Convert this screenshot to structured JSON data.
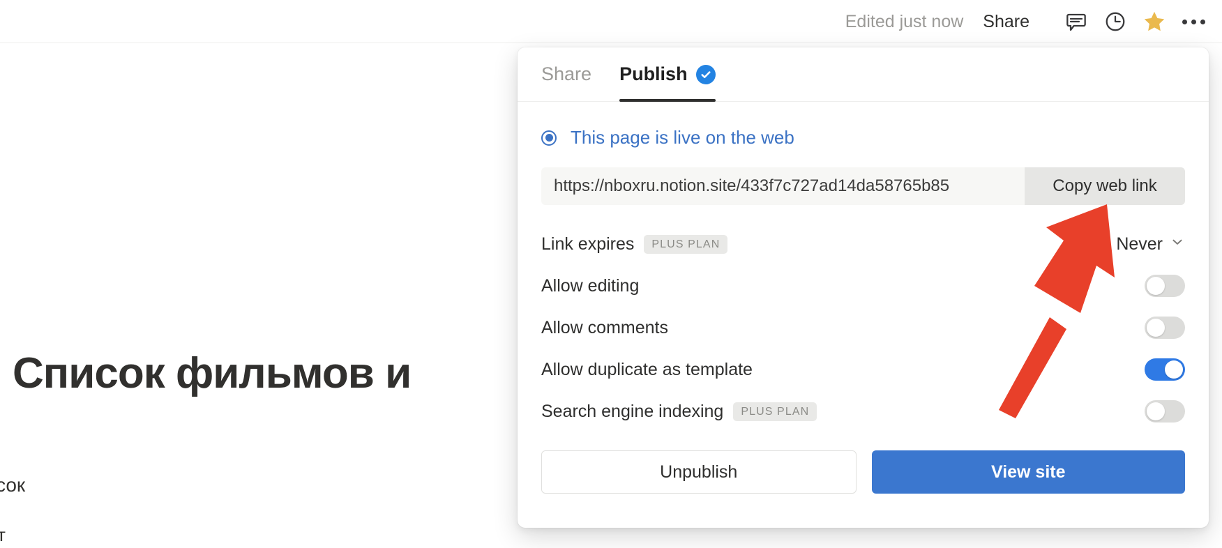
{
  "topbar": {
    "edited_label": "Edited just now",
    "share_label": "Share",
    "icons": {
      "comment": "comment-icon",
      "history": "clock-history-icon",
      "favorite": "star-icon",
      "more": "more-options-icon"
    },
    "favorite_color": "#eab94e"
  },
  "background_page": {
    "title": "Список фильмов и",
    "text_fragment": "сок",
    "text_fragment2": "т"
  },
  "dialog": {
    "tabs": [
      {
        "label": "Share",
        "active": false
      },
      {
        "label": "Publish",
        "active": true,
        "badge": "verified-check"
      }
    ],
    "status": {
      "label": "This page is live on the web",
      "color": "#3b72c4"
    },
    "url": {
      "value": "https://nboxru.notion.site/433f7c727ad14da58765b85",
      "copy_label": "Copy web link"
    },
    "settings": [
      {
        "label": "Link expires",
        "badge": "PLUS PLAN",
        "control": "select",
        "value": "Never"
      },
      {
        "label": "Allow editing",
        "badge": null,
        "control": "toggle",
        "on": false
      },
      {
        "label": "Allow comments",
        "badge": null,
        "control": "toggle",
        "on": false
      },
      {
        "label": "Allow duplicate as template",
        "badge": null,
        "control": "toggle",
        "on": true
      },
      {
        "label": "Search engine indexing",
        "badge": "PLUS PLAN",
        "control": "toggle",
        "on": false
      }
    ],
    "footer": {
      "secondary_label": "Unpublish",
      "primary_label": "View site"
    },
    "accent_color": "#3b77cf",
    "toggle_on_color": "#2f7ae5"
  },
  "annotation": {
    "type": "arrow",
    "color": "#e8402a",
    "points_to": "Copy web link"
  }
}
